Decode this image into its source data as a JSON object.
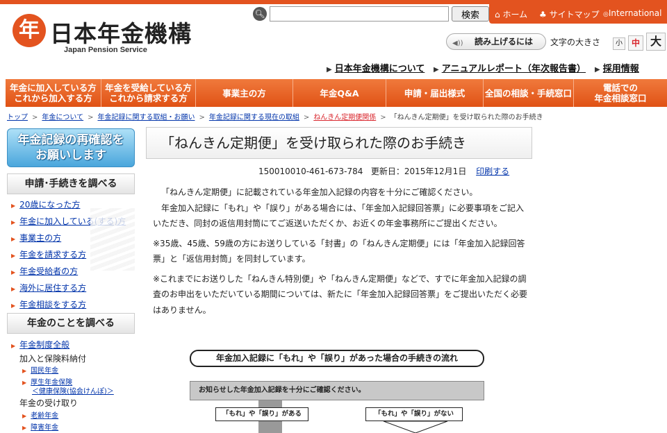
{
  "site": {
    "logo_jp": "日本年金機構",
    "logo_en": "Japan Pension Service",
    "logo_mark": "年"
  },
  "search": {
    "value": "",
    "placeholder": "",
    "button_label": "検索"
  },
  "utility": {
    "home": "ホーム",
    "sitemap": "サイトマップ",
    "international": "International"
  },
  "accessibility": {
    "readaloud_label": "読み上げるには",
    "fontsize_label": "文字の大きさ",
    "fontsize_small": "小",
    "fontsize_medium": "中",
    "fontsize_large": "大"
  },
  "sublinks": [
    "日本年金機構について",
    "アニュアルレポート（年次報告書）",
    "採用情報"
  ],
  "global_nav": [
    "年金に加入している方\nこれから加入する方",
    "年金を受給している方\nこれから請求する方",
    "事業主の方",
    "年金Q&A",
    "申請・届出様式",
    "全国の相談・手続窓口",
    "電話での\n年金相談窓口"
  ],
  "breadcrumb": [
    "トップ",
    "年金について",
    "年金記録に関する取組・お願い",
    "年金記録に関する現在の取組",
    "ねんきん定期便関係",
    "「ねんきん定期便」を受け取られた際のお手続き"
  ],
  "sidebar": {
    "banner": "年金記録の再確認を\nお願いします",
    "section1_title": "申請･手続きを調べる",
    "section1_items": [
      "20歳になった方",
      "年金に加入している(する)方",
      "事業主の方",
      "年金を請求する方",
      "年金受給者の方",
      "海外に居住する方",
      "年金相談をする方"
    ],
    "section2_title": "年金のことを調べる",
    "section2_link1": "年金制度全般",
    "section2_plain1": "加入と保険料納付",
    "section2_sub1": "国民年金",
    "section2_sub2a": "厚生年金保険",
    "section2_sub2b": "＜健康保険(協会けんぽ)＞",
    "section2_plain2": "年金の受け取り",
    "section2_sub3": "老齢年金",
    "section2_sub4": "障害年金"
  },
  "main": {
    "title": "「ねんきん定期便」を受け取られた際のお手続き",
    "doc_id": "150010010-461-673-784",
    "updated": "更新日：2015年12月1日",
    "print": "印刷する",
    "paragraphs": [
      "「ねんきん定期便」に記載されている年金加入記録の内容を十分にご確認ください。",
      "年金加入記録に「もれ」や「誤り」がある場合には、「年金加入記録回答票」に必要事項をご記入いただき、同封の返信用封筒にてご返送いただくか、お近くの年金事務所にご提出ください。",
      "※35歳、45歳、59歳の方にお送りしている「封書」の「ねんきん定期便」には「年金加入記録回答票」と「返信用封筒」を同封しています。",
      "※これまでにお送りした「ねんきん特別便」や「ねんきん定期便」などで、すでに年金加入記録の調査のお申出をいただいている期間については、新たに「年金加入記録回答票」をご提出いただく必要はありません。"
    ]
  },
  "flow": {
    "title": "年金加入記録に「もれ」や「誤り」があった場合の手続きの流れ",
    "bar": "お知らせした年金加入記録を十分にご確認ください。",
    "left_box": "「もれ」や「誤り」がある",
    "right_box": "「もれ」や「誤り」がない"
  },
  "colors": {
    "brand_orange": "#e3531f",
    "link_blue": "#0033aa",
    "banner_blue": "#4aa6dc"
  }
}
